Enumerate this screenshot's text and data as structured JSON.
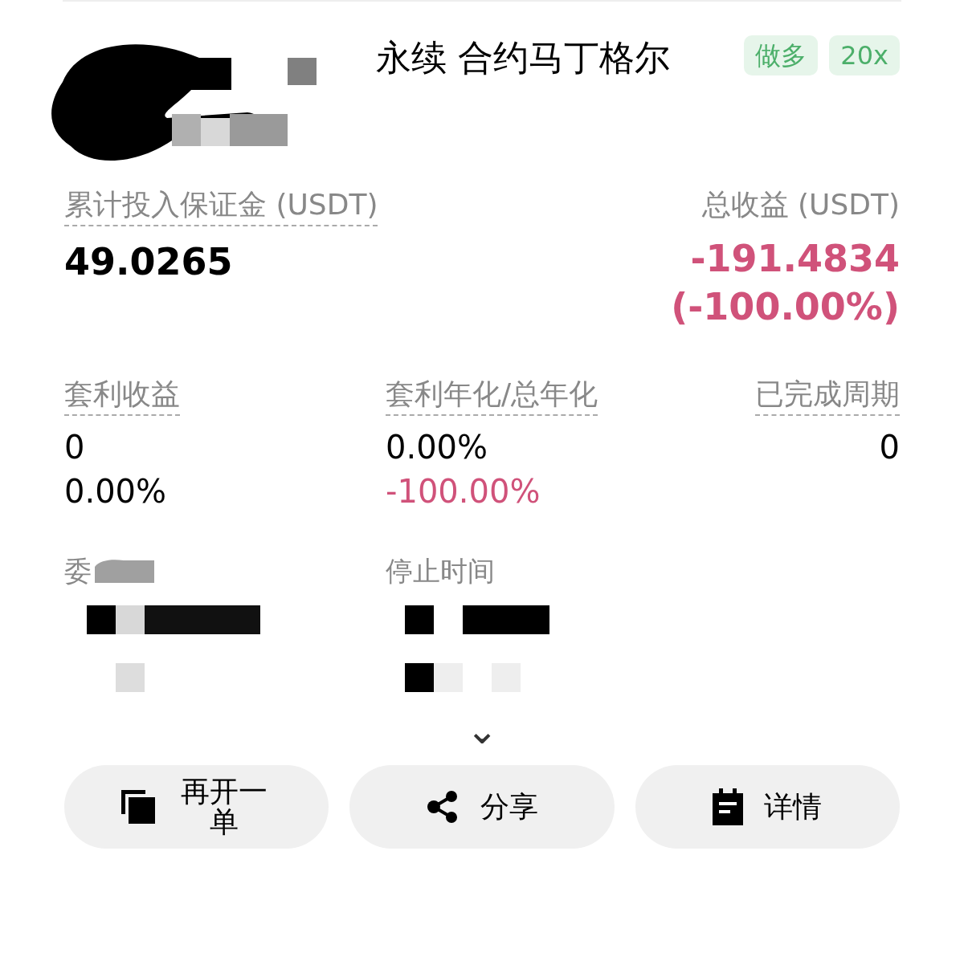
{
  "header": {
    "title": "永续 合约马丁格尔",
    "tags": [
      "做多",
      "20x"
    ]
  },
  "summary": [
    {
      "label": "累计投入保证金 (USDT)",
      "values": [
        "49.0265"
      ],
      "negative": false
    },
    {
      "label": "总收益 (USDT)",
      "values": [
        "-191.4834",
        "(-100.00%)"
      ],
      "negative": true
    }
  ],
  "stats": [
    {
      "label": "套利收益",
      "values": [
        {
          "text": "0",
          "negative": false
        },
        {
          "text": "0.00%",
          "negative": false
        }
      ]
    },
    {
      "label": "套利年化/总年化",
      "values": [
        {
          "text": "0.00%",
          "negative": false
        },
        {
          "text": "-100.00%",
          "negative": true
        }
      ]
    },
    {
      "label": "已完成周期",
      "values": [
        {
          "text": "0",
          "negative": false
        }
      ]
    }
  ],
  "times": [
    {
      "label": "委"
    },
    {
      "label": "停止时间"
    }
  ],
  "expand": {
    "glyph": "⌄"
  },
  "buttons": [
    {
      "label": "再开一单",
      "kind": "copy"
    },
    {
      "label": "分享",
      "kind": "share"
    },
    {
      "label": "详情",
      "kind": "details"
    }
  ]
}
